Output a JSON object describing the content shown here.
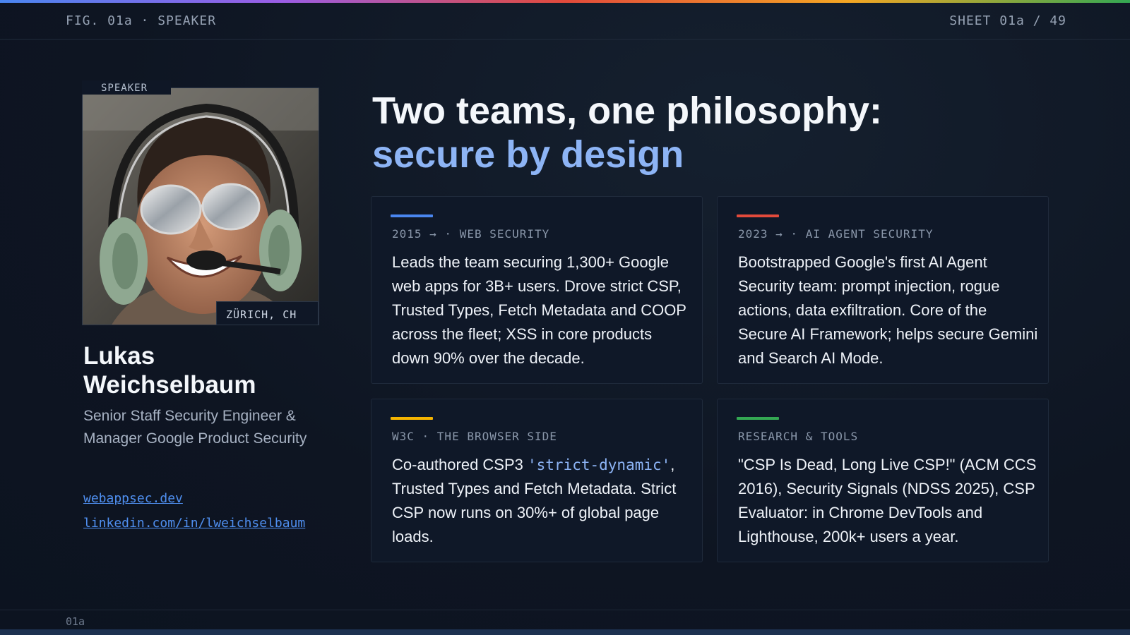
{
  "header": {
    "figure_label": "FIG. 01a · SPEAKER",
    "sheet_label": "SHEET 01a / 49"
  },
  "speaker": {
    "photo_tag": "SPEAKER",
    "location": "ZÜRICH, CH",
    "name_line1": "Lukas",
    "name_line2": "Weichselbaum",
    "role_line1": "Senior Staff Security Engineer &",
    "role_line2": "Manager Google Product Security",
    "links": [
      "webappsec.dev",
      "linkedin.com/in/lweichselbaum"
    ]
  },
  "headline": {
    "line1": "Two teams, one philosophy:",
    "line2": "secure by design"
  },
  "cards": [
    {
      "accent": "#4a86f0",
      "kicker": "2015 → · WEB SECURITY",
      "body": "Leads the team securing 1,300+ Google web apps for 3B+ users. Drove strict CSP, Trusted Types, Fetch Metadata and COOP across the fleet; XSS in core products down 90% over the decade."
    },
    {
      "accent": "#e24a3b",
      "kicker": "2023 → · AI AGENT SECURITY",
      "body": "Bootstrapped Google's first AI Agent Security team: prompt injection, rogue actions, data exfiltration. Core of the Secure AI Framework; helps secure Gemini and Search AI Mode."
    },
    {
      "accent": "#f5b400",
      "kicker": "W3C · THE BROWSER SIDE",
      "body_before": "Co-authored CSP3 ",
      "body_code": "'strict-dynamic'",
      "body_after": ", Trusted Types and Fetch Metadata. Strict CSP now runs on 30%+ of global page loads."
    },
    {
      "accent": "#34a853",
      "kicker": "RESEARCH & TOOLS",
      "body": "\"CSP Is Dead, Long Live CSP!\" (ACM CCS 2016), Security Signals (NDSS 2025), CSP Evaluator: in Chrome DevTools and Lighthouse, 200k+ users a year."
    }
  ],
  "footer": {
    "slide_number": "01a"
  }
}
